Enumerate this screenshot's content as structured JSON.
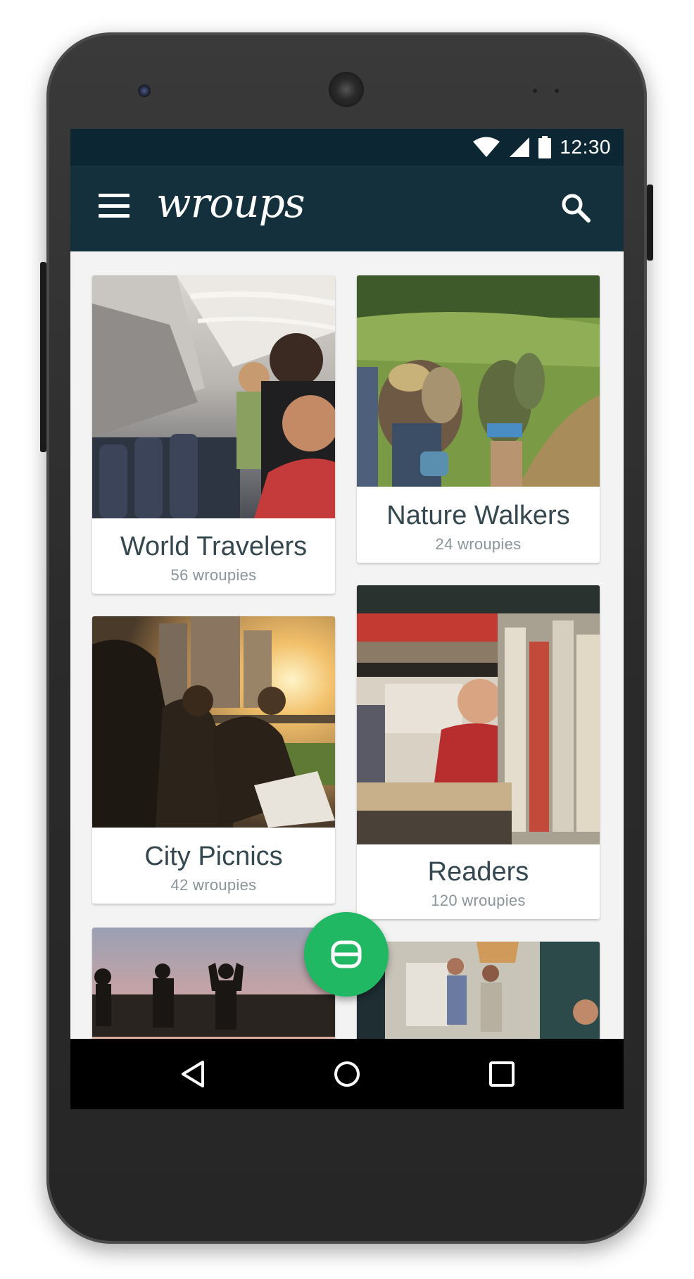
{
  "status_bar": {
    "time": "12:30"
  },
  "app_bar": {
    "logo_text": "wroups"
  },
  "cards": [
    {
      "title": "World Travelers",
      "subtitle": "56 wroupies"
    },
    {
      "title": "Nature Walkers",
      "subtitle": "24 wroupies"
    },
    {
      "title": "City Picnics",
      "subtitle": "42 wroupies"
    },
    {
      "title": "Readers",
      "subtitle": "120 wroupies"
    }
  ],
  "colors": {
    "status_bar": "#0c2733",
    "app_bar": "#14303d",
    "fab": "#20b863",
    "card_title": "#35474f",
    "card_subtitle": "#8a959a"
  },
  "icons": [
    "menu-icon",
    "search-icon",
    "wifi-icon",
    "cell-signal-icon",
    "battery-icon",
    "fab-group-icon",
    "back-icon",
    "home-icon",
    "recents-icon"
  ]
}
